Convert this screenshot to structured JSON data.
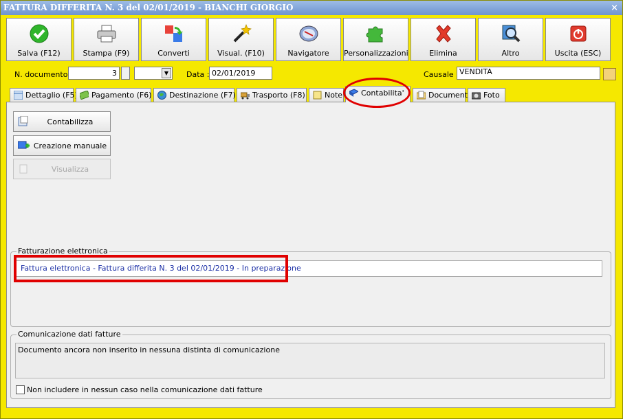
{
  "window": {
    "title": "FATTURA DIFFERITA N. 3 del 02/01/2019 - BIANCHI GIORGIO",
    "close": "×"
  },
  "toolbar": [
    {
      "label": "Salva (F12)",
      "icon": "check-icon"
    },
    {
      "label": "Stampa (F9)",
      "icon": "printer-icon"
    },
    {
      "label": "Converti",
      "icon": "convert-icon"
    },
    {
      "label": "Visual. (F10)",
      "icon": "magic-wand-icon"
    },
    {
      "label": "Navigatore",
      "icon": "compass-icon"
    },
    {
      "label": "Personalizzazioni",
      "icon": "puzzle-icon"
    },
    {
      "label": "Elimina",
      "icon": "delete-x-icon"
    },
    {
      "label": "Altro",
      "icon": "magnifier-icon"
    },
    {
      "label": "Uscita (ESC)",
      "icon": "power-icon"
    }
  ],
  "header": {
    "doc_label": "N. documento :",
    "doc_value": "3",
    "date_label": "Data :",
    "date_value": "02/01/2019",
    "causale_label": "Causale :",
    "causale_value": "VENDITA"
  },
  "tabs": [
    {
      "label": "Dettaglio (F5)",
      "icon": "grid-icon"
    },
    {
      "label": "Pagamento (F6)",
      "icon": "money-icon"
    },
    {
      "label": "Destinazione (F7)",
      "icon": "globe-icon"
    },
    {
      "label": "Trasporto (F8)",
      "icon": "truck-icon"
    },
    {
      "label": "Note",
      "icon": "note-icon"
    },
    {
      "label": "Contabilita'",
      "icon": "book-icon",
      "active": true
    },
    {
      "label": "Documenti",
      "icon": "folder-icon"
    },
    {
      "label": "Foto",
      "icon": "camera-icon"
    }
  ],
  "actions": {
    "contabilizza": "Contabilizza",
    "creazione": "Creazione manuale",
    "visualizza": "Visualizza"
  },
  "fe": {
    "title": "Fatturazione elettronica",
    "status": "Fattura elettronica - Fattura differita N. 3 del 02/01/2019 - In preparazione"
  },
  "cdf": {
    "title": "Comunicazione dati fatture",
    "text": "Documento ancora non inserito in nessuna distinta di comunicazione",
    "checkbox": "Non includere in nessun caso nella comunicazione dati fatture"
  },
  "colors": {
    "accent": "#f5e800",
    "highlight": "#e00000",
    "link": "#1b2fa6"
  }
}
